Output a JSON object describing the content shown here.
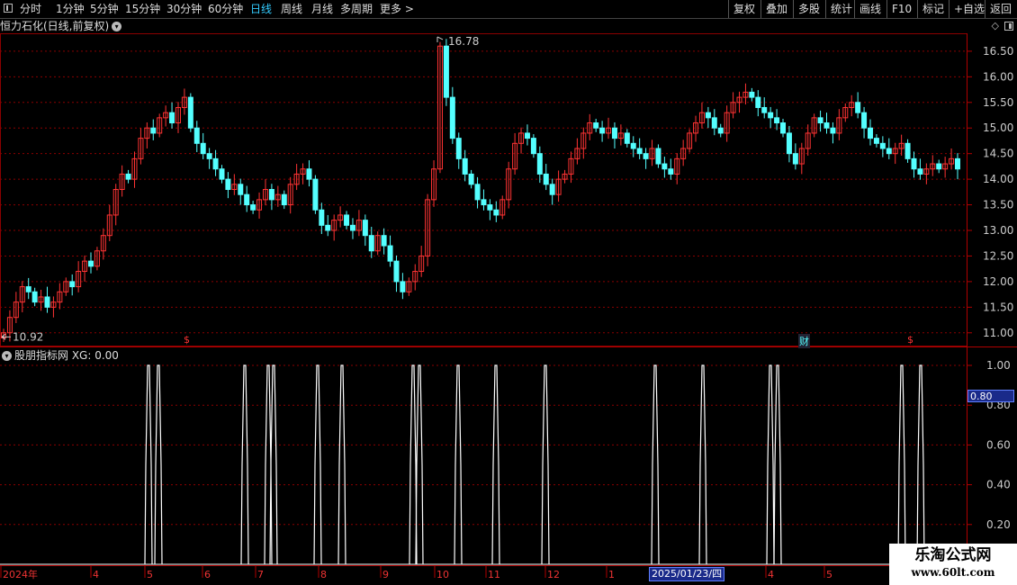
{
  "toolbar": {
    "left_items": [
      "分时",
      "1分钟",
      "5分钟",
      "15分钟",
      "30分钟",
      "60分钟",
      "日线",
      "周线",
      "月线",
      "多周期",
      "更多 >"
    ],
    "active": "日线",
    "right_items": [
      "复权",
      "叠加",
      "多股",
      "统计",
      "画线",
      "F10",
      "标记",
      "+自选",
      "返回"
    ]
  },
  "chart_title": "恒力石化(日线,前复权)",
  "indicator_title": "股朋指标网 XG: 0.00",
  "price_axis": [
    "16.50",
    "16.00",
    "15.50",
    "15.00",
    "14.50",
    "14.00",
    "13.50",
    "13.00",
    "12.50",
    "12.00",
    "11.50",
    "11.00"
  ],
  "indicator_axis": [
    "1.00",
    "0.80",
    "0.60",
    "0.40",
    "0.20"
  ],
  "current_value_label": "0.80",
  "high_label": "16.78",
  "low_label": "10.92",
  "markers": {
    "s1": "$",
    "cai": "财",
    "s2": "$"
  },
  "date_axis": [
    "2024年",
    "4",
    "5",
    "6",
    "7",
    "8",
    "9",
    "10",
    "11",
    "12",
    "1",
    "4",
    "5"
  ],
  "cursor_date": "2025/01/23/四",
  "watermark": {
    "line1": "乐淘公式网",
    "line2": "www.60lt.com"
  },
  "colors": {
    "up": "#ff3333",
    "down": "#54ffff",
    "grid": "#8b0000",
    "signal": "#ffffff",
    "accent": "#33ccff"
  },
  "chart_data": {
    "type": "candlestick",
    "price_range": [
      10.75,
      16.85
    ],
    "indicator_range": [
      0,
      1.0
    ],
    "signal_positions": [
      165,
      176,
      272,
      298,
      304,
      353,
      380,
      459,
      466,
      509,
      551,
      606,
      728,
      781,
      856,
      864,
      1002,
      1023
    ],
    "closes": [
      11.0,
      11.3,
      11.6,
      11.9,
      11.8,
      11.6,
      11.7,
      11.5,
      11.6,
      11.8,
      12.0,
      11.9,
      12.2,
      12.4,
      12.3,
      12.6,
      12.9,
      13.3,
      13.8,
      14.1,
      14.0,
      14.4,
      14.8,
      15.0,
      14.9,
      15.2,
      15.3,
      15.1,
      15.4,
      15.6,
      15.0,
      14.7,
      14.5,
      14.4,
      14.2,
      14.0,
      13.8,
      13.9,
      13.7,
      13.5,
      13.4,
      13.6,
      13.8,
      13.6,
      13.7,
      13.5,
      13.9,
      14.1,
      14.2,
      14.0,
      13.4,
      13.1,
      13.0,
      13.2,
      13.3,
      13.1,
      13.0,
      13.2,
      12.9,
      12.6,
      12.9,
      12.7,
      12.4,
      12.0,
      11.8,
      12.0,
      12.2,
      12.5,
      13.6,
      14.2,
      16.6,
      15.6,
      14.8,
      14.4,
      14.1,
      13.9,
      13.6,
      13.5,
      13.4,
      13.3,
      13.6,
      14.2,
      14.7,
      14.9,
      14.8,
      14.5,
      14.1,
      13.9,
      13.7,
      14.0,
      14.1,
      14.4,
      14.6,
      14.9,
      15.1,
      15.0,
      14.9,
      15.0,
      14.8,
      14.9,
      14.7,
      14.6,
      14.5,
      14.4,
      14.6,
      14.3,
      14.2,
      14.1,
      14.4,
      14.6,
      14.9,
      15.1,
      15.3,
      15.2,
      15.0,
      14.9,
      15.3,
      15.5,
      15.6,
      15.7,
      15.6,
      15.4,
      15.3,
      15.2,
      15.1,
      14.9,
      14.5,
      14.3,
      14.6,
      14.9,
      15.2,
      15.1,
      15.0,
      14.9,
      15.2,
      15.4,
      15.5,
      15.3,
      15.0,
      14.8,
      14.7,
      14.6,
      14.5,
      14.6,
      14.7,
      14.4,
      14.2,
      14.1,
      14.2,
      14.3,
      14.2,
      14.3,
      14.4,
      14.2
    ]
  }
}
